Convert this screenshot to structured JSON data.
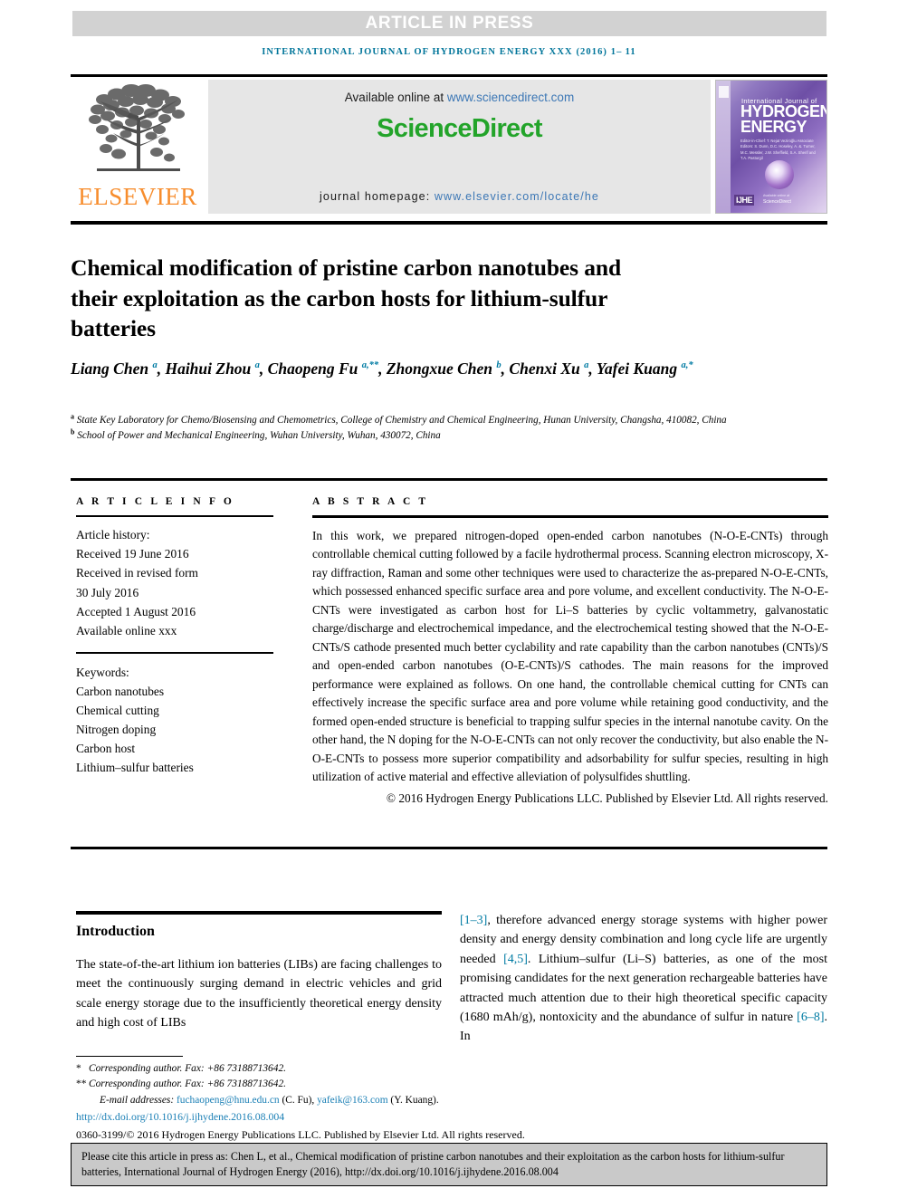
{
  "header": {
    "article_in_press": "ARTICLE IN PRESS",
    "running_head": "INTERNATIONAL JOURNAL OF HYDROGEN ENERGY XXX (2016) 1– 11"
  },
  "masthead": {
    "publisher_name": "ELSEVIER",
    "available_prefix": "Available online at ",
    "available_url": "www.sciencedirect.com",
    "sciencedirect_logo": "ScienceDirect",
    "homepage_prefix": "journal homepage: ",
    "homepage_url": "www.elsevier.com/locate/he",
    "cover": {
      "line_small": "International Journal of",
      "line_1": "HYDROGEN",
      "line_2": "ENERGY",
      "editors": "Editor-in-Chief: T. Nejat Veziroğlu   Associate Editors: S. Dunn, D.C. Hoseley, A. &. Turner, M.C. Messler, J.W. Sheffield, S.A. Sherif and T.A. Pasturgil",
      "imprint": "IJHE",
      "sciencedirect_tag": "ScienceDirect",
      "avail_tag": "Available online at"
    }
  },
  "article": {
    "title": "Chemical modification of pristine carbon nanotubes and their exploitation as the carbon hosts for lithium-sulfur batteries",
    "authors": [
      {
        "name": "Liang Chen",
        "sup": "a",
        "sep": ", "
      },
      {
        "name": "Haihui Zhou",
        "sup": "a",
        "sep": ", "
      },
      {
        "name": "Chaopeng Fu",
        "sup": "a,**",
        "sep": ", "
      },
      {
        "name": "Zhongxue Chen",
        "sup": "b",
        "sep": ", "
      },
      {
        "name": "Chenxi Xu",
        "sup": "a",
        "sep": ", "
      },
      {
        "name": "Yafei Kuang",
        "sup": "a,*",
        "sep": ""
      }
    ],
    "affiliations": [
      {
        "mark": "a",
        "text": "State Key Laboratory for Chemo/Biosensing and Chemometrics, College of Chemistry and Chemical Engineering, Hunan University, Changsha, 410082, China"
      },
      {
        "mark": "b",
        "text": "School of Power and Mechanical Engineering, Wuhan University, Wuhan, 430072, China"
      }
    ]
  },
  "article_info": {
    "heading": "A R T I C L E   I N F O",
    "history_label": "Article history:",
    "history": [
      "Received 19 June 2016",
      "Received in revised form",
      "30 July 2016",
      "Accepted 1 August 2016",
      "Available online xxx"
    ],
    "keywords_label": "Keywords:",
    "keywords": [
      "Carbon nanotubes",
      "Chemical cutting",
      "Nitrogen doping",
      "Carbon host",
      "Lithium–sulfur batteries"
    ]
  },
  "abstract": {
    "heading": "A B S T R A C T",
    "body": "In this work, we prepared nitrogen-doped open-ended carbon nanotubes (N-O-E-CNTs) through controllable chemical cutting followed by a facile hydrothermal process. Scanning electron microscopy, X-ray diffraction, Raman and some other techniques were used to characterize the as-prepared N-O-E-CNTs, which possessed enhanced specific surface area and pore volume, and excellent conductivity. The N-O-E-CNTs were investigated as carbon host for Li–S batteries by cyclic voltammetry, galvanostatic charge/discharge and electrochemical impedance, and the electrochemical testing showed that the N-O-E-CNTs/S cathode presented much better cyclability and rate capability than the carbon nanotubes (CNTs)/S and open-ended carbon nanotubes (O-E-CNTs)/S cathodes. The main reasons for the improved performance were explained as follows. On one hand, the controllable chemical cutting for CNTs can effectively increase the specific surface area and pore volume while retaining good conductivity, and the formed open-ended structure is beneficial to trapping sulfur species in the internal nanotube cavity. On the other hand, the N doping for the N-O-E-CNTs can not only recover the conductivity, but also enable the N-O-E-CNTs to possess more superior compatibility and adsorbability for sulfur species, resulting in high utilization of active material and effective alleviation of polysulfides shuttling.",
    "copyright": "© 2016 Hydrogen Energy Publications LLC. Published by Elsevier Ltd. All rights reserved."
  },
  "introduction": {
    "heading": "Introduction",
    "left_paragraph": "The state-of-the-art lithium ion batteries (LIBs) are facing challenges to meet the continuously surging demand in electric vehicles and grid scale energy storage due to the insufficiently theoretical energy density and high cost of LIBs",
    "right_parts": [
      {
        "type": "ref",
        "text": "[1–3]"
      },
      {
        "type": "text",
        "text": ", therefore advanced energy storage systems with higher power density and energy density combination and long cycle life are urgently needed "
      },
      {
        "type": "ref",
        "text": "[4,5]"
      },
      {
        "type": "text",
        "text": ". Lithium–sulfur (Li–S) batteries, as one of the most promising candidates for the next generation rechargeable batteries have attracted much attention due to their high theoretical specific capacity (1680 mAh/g), nontoxicity and the abundance of sulfur in nature "
      },
      {
        "type": "ref",
        "text": "[6–8]"
      },
      {
        "type": "text",
        "text": ". In"
      }
    ]
  },
  "footnotes": {
    "corresponding_1": {
      "mark": "*",
      "text": "Corresponding author. Fax: +86 73188713642."
    },
    "corresponding_2": {
      "mark": "**",
      "text": "Corresponding author. Fax: +86 73188713642."
    },
    "email_label": "E-mail addresses: ",
    "email_1": "fuchaopeng@hnu.edu.cn",
    "email_1_owner": " (C. Fu), ",
    "email_2": "yafeik@163.com",
    "email_2_owner": " (Y. Kuang).",
    "doi": "http://dx.doi.org/10.1016/j.ijhydene.2016.08.004",
    "issn_line": "0360-3199/© 2016 Hydrogen Energy Publications LLC. Published by Elsevier Ltd. All rights reserved."
  },
  "cite_box": {
    "text": "Please cite this article in press as: Chen L, et al., Chemical modification of pristine carbon nanotubes and their exploitation as the carbon hosts for lithium-sulfur batteries, International Journal of Hydrogen Energy (2016), http://dx.doi.org/10.1016/j.ijhydene.2016.08.004"
  },
  "colors": {
    "accent_teal": "#007ba3",
    "link_blue": "#1a7fb5",
    "elsevier_orange": "#f78d2d",
    "sciencedirect_green": "#23a42a",
    "band_gray": "#d2d2d2",
    "cite_box_gray": "#c9c9c9"
  }
}
